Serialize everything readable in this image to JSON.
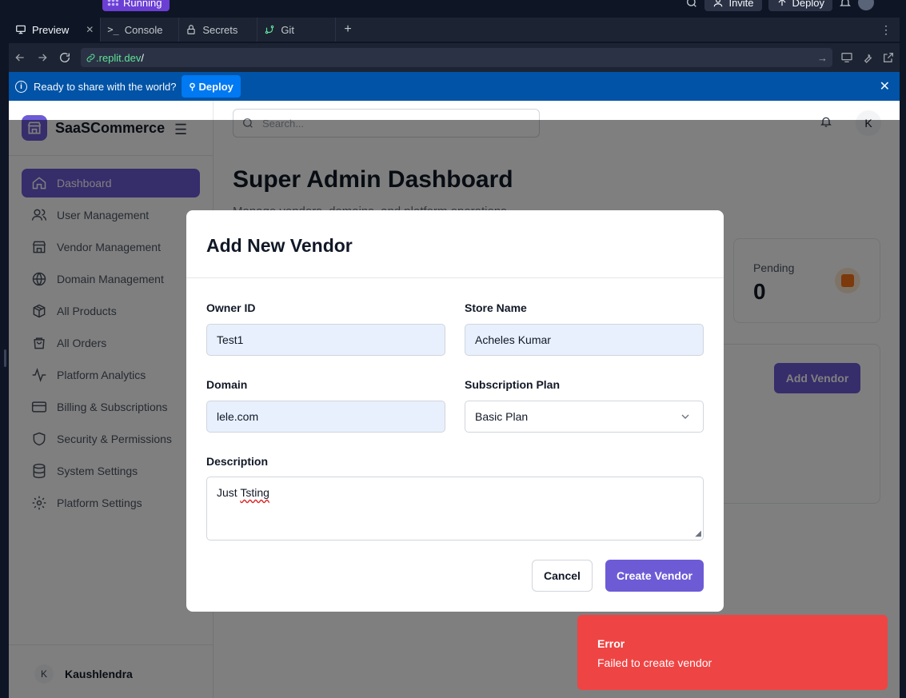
{
  "replit": {
    "run_status": "Running",
    "invite_label": "Invite",
    "deploy_top_label": "Deploy",
    "tabs": [
      {
        "label": "Preview"
      },
      {
        "label": "Console"
      },
      {
        "label": "Secrets"
      },
      {
        "label": "Git"
      }
    ],
    "url_domain": ".replit.dev",
    "url_path": "/",
    "banner_text": "Ready to share with the world?",
    "banner_button": "Deploy"
  },
  "app": {
    "brand": "SaaSCommerce",
    "search_placeholder": "Search...",
    "avatar_initial": "K",
    "menu": [
      {
        "label": "Dashboard",
        "icon": "home-icon"
      },
      {
        "label": "User Management",
        "icon": "users-icon"
      },
      {
        "label": "Vendor Management",
        "icon": "store-icon"
      },
      {
        "label": "Domain Management",
        "icon": "globe-icon"
      },
      {
        "label": "All Products",
        "icon": "package-icon"
      },
      {
        "label": "All Orders",
        "icon": "shopping-bag-icon"
      },
      {
        "label": "Platform Analytics",
        "icon": "activity-icon"
      },
      {
        "label": "Billing & Subscriptions",
        "icon": "credit-card-icon"
      },
      {
        "label": "Security & Permissions",
        "icon": "shield-icon"
      },
      {
        "label": "System Settings",
        "icon": "database-icon"
      },
      {
        "label": "Platform Settings",
        "icon": "gear-icon"
      }
    ],
    "user": {
      "initial": "K",
      "name": "Kaushlendra"
    },
    "page_title": "Super Admin Dashboard",
    "page_subtitle": "Manage vendors, domains, and platform operations",
    "stat": {
      "label": "Pending",
      "value": "0"
    },
    "add_vendor_label": "Add Vendor"
  },
  "modal": {
    "title": "Add New Vendor",
    "owner_id": {
      "label": "Owner ID",
      "value": "Test1"
    },
    "store_name": {
      "label": "Store Name",
      "value": "Acheles Kumar"
    },
    "domain": {
      "label": "Domain",
      "value": "lele.com"
    },
    "plan": {
      "label": "Subscription Plan",
      "value": "Basic Plan"
    },
    "description": {
      "label": "Description",
      "value_start": "Just ",
      "value_misspelled": "Tsting"
    },
    "cancel_label": "Cancel",
    "create_label": "Create Vendor"
  },
  "toast": {
    "title": "Error",
    "message": "Failed to create vendor"
  },
  "colors": {
    "accent": "#6d5bd6",
    "error": "#ef4444",
    "banner": "#0053a6"
  }
}
